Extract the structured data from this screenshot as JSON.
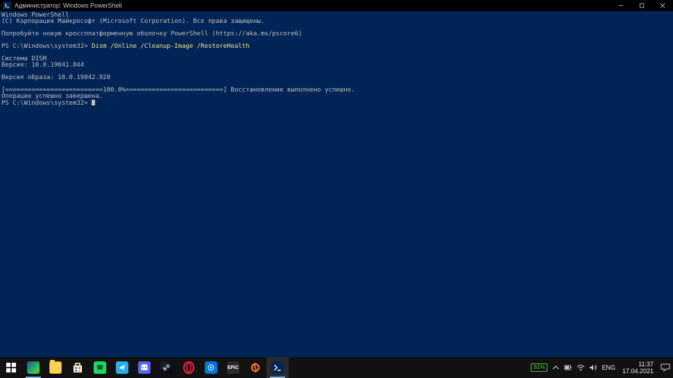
{
  "window": {
    "title": "Администратор: Windows PowerShell"
  },
  "terminal": {
    "header1": "Windows PowerShell",
    "header2": "(C) Корпорация Майкрософт (Microsoft Corporation). Все права защищены.",
    "tryline": "Попробуйте новую кроссплатформенную оболочку PowerShell (https://aka.ms/pscore6)",
    "prompt1": "PS C:\\Windows\\system32> ",
    "cmd": "Dism /Online /Cleanup-Image /RestoreHealth",
    "dism1": "Система DISM",
    "dism2": "Версия: 10.0.19041.844",
    "imgver": "Версия образа: 10.0.19042.928",
    "progress": "[==========================100.0%==========================] Восстановление выполнено успешно.",
    "done": "Операция успешно завершена.",
    "prompt2": "PS C:\\Windows\\system32> "
  },
  "taskbar": {
    "epic_label": "EPIC",
    "battery_pct": "81%",
    "lang": "ENG",
    "time": "11:37",
    "date": "17.04.2021"
  }
}
